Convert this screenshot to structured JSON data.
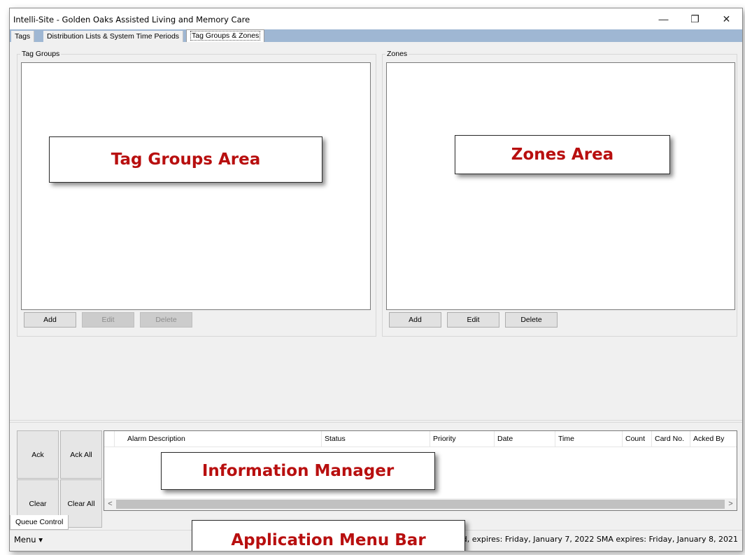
{
  "window": {
    "title": "Intelli-Site - Golden Oaks Assisted Living and Memory Care",
    "minimize_glyph": "—",
    "restore_glyph": "❐",
    "close_glyph": "✕"
  },
  "tabs": [
    {
      "label": "Tags"
    },
    {
      "label": "Distribution Lists & System Time Periods"
    },
    {
      "label": "Tag Groups & Zones",
      "active": true
    }
  ],
  "tag_groups": {
    "label": "Tag Groups",
    "add": "Add",
    "edit": "Edit",
    "delete": "Delete",
    "edit_enabled": false,
    "delete_enabled": false
  },
  "zones": {
    "label": "Zones",
    "add": "Add",
    "edit": "Edit",
    "delete": "Delete"
  },
  "callouts": {
    "tag_groups_area": "Tag Groups Area",
    "zones_area": "Zones Area",
    "information_manager": "Information Manager",
    "application_menu_bar": "Application Menu Bar"
  },
  "queue": {
    "ack": "Ack",
    "ack_all": "Ack All",
    "clear": "Clear",
    "clear_all": "Clear All",
    "tab_label": "Queue Control"
  },
  "alarm_grid": {
    "columns": [
      "Alarm Description",
      "Status",
      "Priority",
      "Date",
      "Time",
      "Count",
      "Card No.",
      "Acked By"
    ],
    "scroll_left": "<",
    "scroll_right": ">"
  },
  "statusbar": {
    "menu_label": "Menu",
    "menu_arrow": "▾",
    "license_text": "Valid, expires: Friday, January 7, 2022 SMA expires: Friday, January 8, 2021"
  },
  "colors": {
    "tabstrip": "#9fb7d3",
    "callout_text": "#b80f0f"
  }
}
